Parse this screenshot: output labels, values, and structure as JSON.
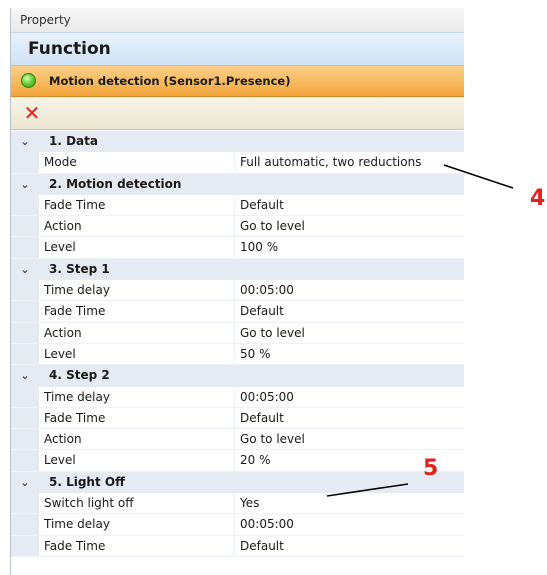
{
  "panel": {
    "title": "Property",
    "header": "Function",
    "sensor": {
      "label": "Motion detection (Sensor1.Presence)",
      "status_icon": "green-status-icon",
      "status_color": "#4cb82a"
    },
    "toolbar": {
      "delete_icon": "delete-icon",
      "delete_glyph": "✕",
      "delete_color": "#e2231a"
    }
  },
  "categories": [
    {
      "label": "1. Data",
      "chevron": "⌄",
      "rows": [
        {
          "name": "Mode",
          "value": "Full automatic, two reductions"
        }
      ]
    },
    {
      "label": "2. Motion detection",
      "chevron": "⌄",
      "rows": [
        {
          "name": "Fade Time",
          "value": "Default"
        },
        {
          "name": "Action",
          "value": "Go to level"
        },
        {
          "name": "Level",
          "value": "100 %"
        }
      ]
    },
    {
      "label": "3. Step 1",
      "chevron": "⌄",
      "rows": [
        {
          "name": "Time delay",
          "value": "00:05:00"
        },
        {
          "name": "Fade Time",
          "value": "Default"
        },
        {
          "name": "Action",
          "value": "Go to level"
        },
        {
          "name": "Level",
          "value": "50 %"
        }
      ]
    },
    {
      "label": "4. Step 2",
      "chevron": "⌄",
      "rows": [
        {
          "name": "Time delay",
          "value": "00:05:00"
        },
        {
          "name": "Fade Time",
          "value": "Default"
        },
        {
          "name": "Action",
          "value": "Go to level"
        },
        {
          "name": "Level",
          "value": "20 %"
        }
      ]
    },
    {
      "label": "5. Light Off",
      "chevron": "⌄",
      "rows": [
        {
          "name": "Switch light off",
          "value": "Yes"
        },
        {
          "name": "Time delay",
          "value": "00:05:00"
        },
        {
          "name": "Fade Time",
          "value": "Default"
        }
      ]
    }
  ],
  "callouts": [
    {
      "number": "4",
      "color": "#e0241b"
    },
    {
      "number": "5",
      "color": "#e0241b"
    }
  ]
}
